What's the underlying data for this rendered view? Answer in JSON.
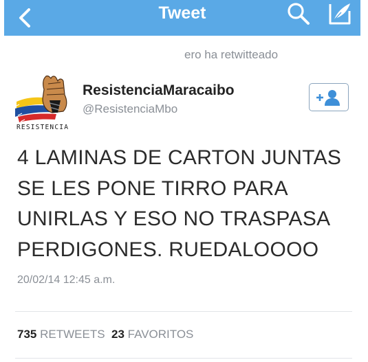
{
  "nav": {
    "title": "Tweet",
    "bar_color": "#5aa9e6",
    "back_icon": "chevron-left",
    "search_icon": "magnifier",
    "compose_icon": "quill"
  },
  "retweet_notice": "ero ha retwitteado",
  "author": {
    "display_name": "ResistenciaMaracaibo",
    "handle": "@ResistenciaMbo",
    "avatar_caption": "RESISTENCIA",
    "follow_icon": "add-person"
  },
  "tweet": {
    "text": "4 LAMINAS DE CARTON JUNTAS\nSE LES PONE TIRRO PARA\nUNIRLAS Y ESO NO TRASPASA\nPERDIGONES. RUEDALOOOO",
    "timestamp": "20/02/14 12:45 a.m."
  },
  "stats": {
    "retweets_count": "735",
    "retweets_label": "RETWEETS",
    "favorites_count": "23",
    "favorites_label": "FAVORITOS"
  }
}
